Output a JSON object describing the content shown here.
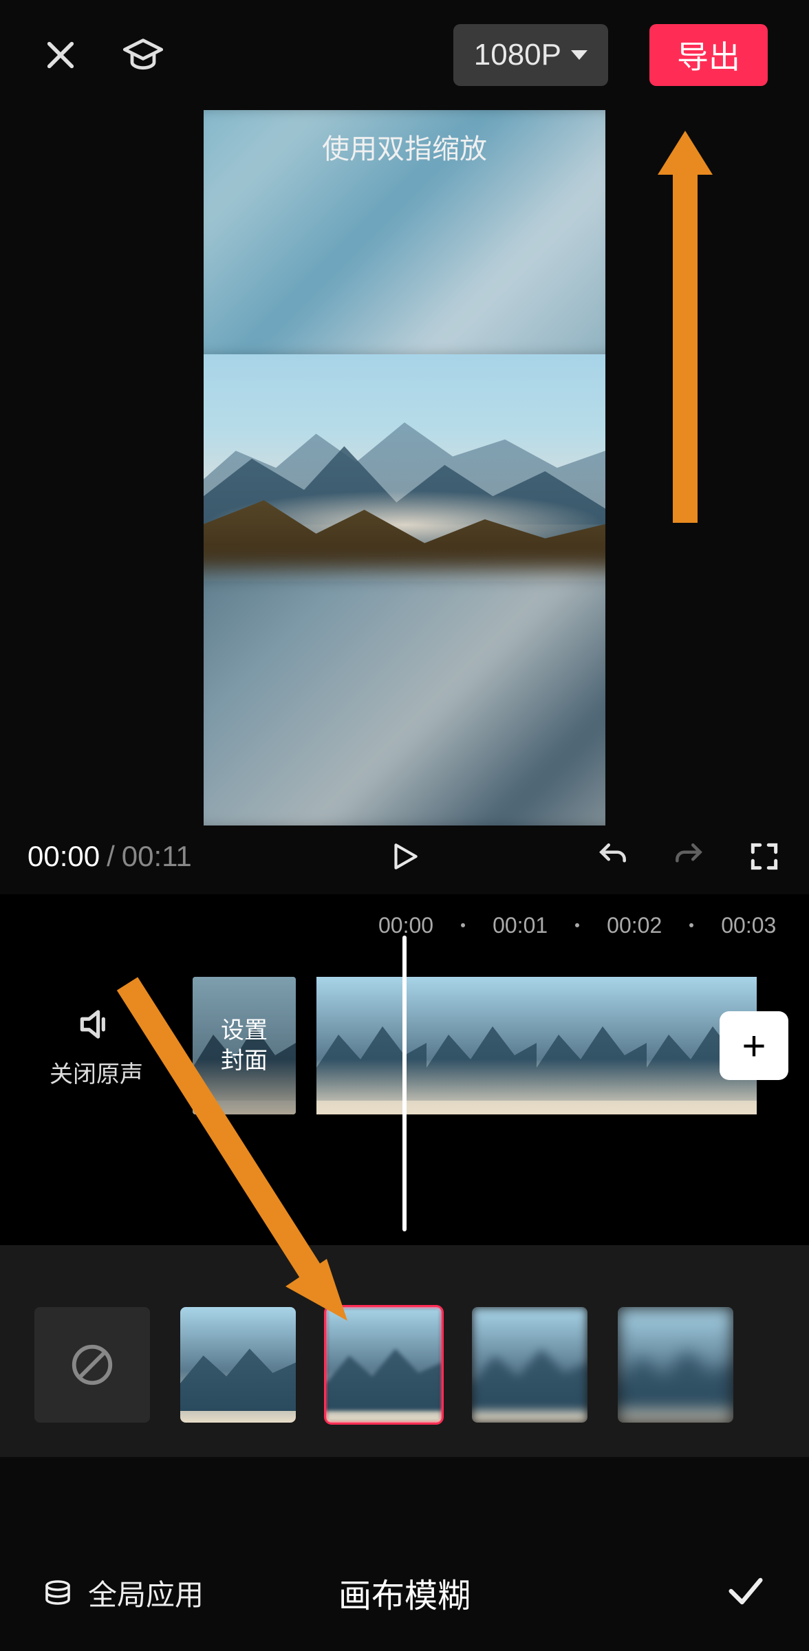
{
  "header": {
    "resolution_label": "1080P",
    "export_label": "导出"
  },
  "preview": {
    "hint": "使用双指缩放"
  },
  "playback": {
    "current_time": "00:00",
    "total_time": "00:11"
  },
  "timeline": {
    "ticks": [
      "00:00",
      "00:01",
      "00:02",
      "00:03"
    ],
    "mute_label": "关闭原声",
    "cover_label": "设置\n封面"
  },
  "blur_panel": {
    "selected_index": 2
  },
  "footer": {
    "global_apply_label": "全局应用",
    "title": "画布模糊"
  },
  "icons": {
    "close": "close-icon",
    "help": "graduation-cap-icon",
    "play": "play-icon",
    "undo": "undo-icon",
    "redo": "redo-icon",
    "fullscreen": "fullscreen-icon",
    "speaker": "speaker-icon",
    "forbid": "no-symbol-icon",
    "add": "plus-icon",
    "stack": "stack-icon",
    "check": "check-icon"
  }
}
